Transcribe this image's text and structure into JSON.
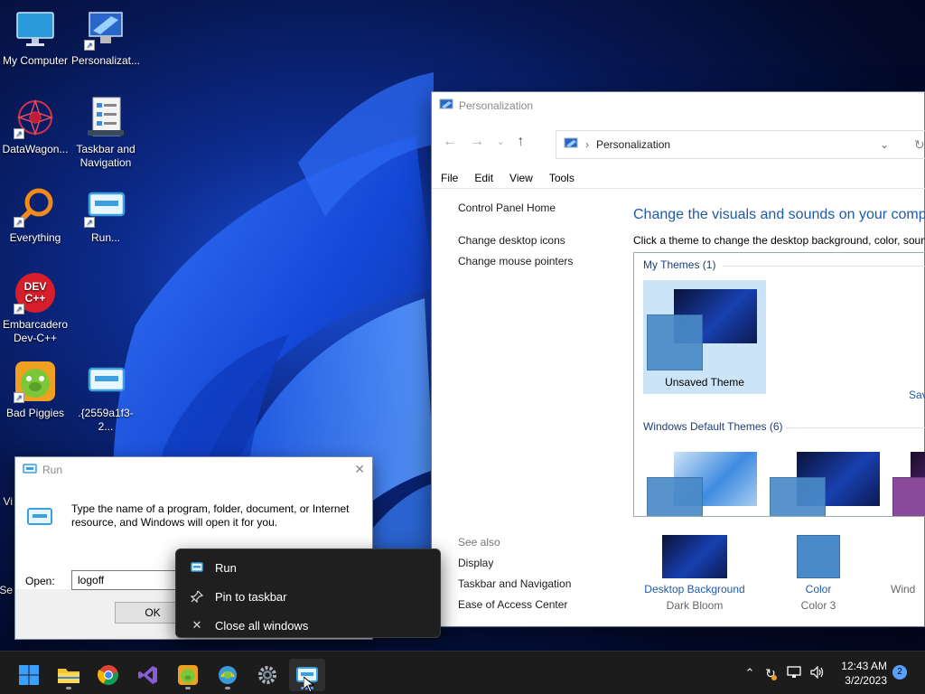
{
  "desktop": {
    "icons": [
      {
        "label": "My Computer"
      },
      {
        "label": "Personalizat..."
      },
      {
        "label": "DataWagon..."
      },
      {
        "label": "Taskbar and Navigation"
      },
      {
        "label": "Everything"
      },
      {
        "label": "Run..."
      },
      {
        "label": "Embarcadero Dev-C++"
      },
      {
        "label": "Bad Piggies"
      },
      {
        "label": ".{2559a1f3-2..."
      }
    ],
    "partial_left_labels": [
      "Vi",
      "Se"
    ]
  },
  "personalization": {
    "title": "Personalization",
    "breadcrumb": "Personalization",
    "menu": [
      "File",
      "Edit",
      "View",
      "Tools"
    ],
    "left_links": [
      "Control Panel Home",
      "Change desktop icons",
      "Change mouse pointers"
    ],
    "heading": "Change the visuals and sounds on your compu",
    "subheading": "Click a theme to change the desktop background, color, soun",
    "my_themes_header": "My Themes (1)",
    "unsaved_theme": "Unsaved Theme",
    "save_link": "Sav",
    "default_themes_header": "Windows Default Themes (6)",
    "see_also": "See also",
    "see_also_links": [
      "Display",
      "Taskbar and Navigation",
      "Ease of Access Center"
    ],
    "bottom": [
      {
        "label": "Desktop Background",
        "sub": "Dark Bloom"
      },
      {
        "label": "Color",
        "sub": "Color 3"
      },
      {
        "label": "",
        "sub": "Wind"
      }
    ]
  },
  "run": {
    "title": "Run",
    "description": "Type the name of a program, folder, document, or Internet resource, and Windows will open it for you.",
    "open_label": "Open:",
    "input_value": "logoff",
    "ok_label": "OK"
  },
  "jumplist": {
    "items": [
      "Run",
      "Pin to taskbar",
      "Close all windows"
    ]
  },
  "taskbar": {
    "time": "12:43 AM",
    "date": "3/2/2023",
    "notification_count": "2"
  },
  "colors": {
    "accent": "#1e5aa8",
    "taskbar": "#1c1c1c",
    "jumplist": "#1f1f1f"
  }
}
